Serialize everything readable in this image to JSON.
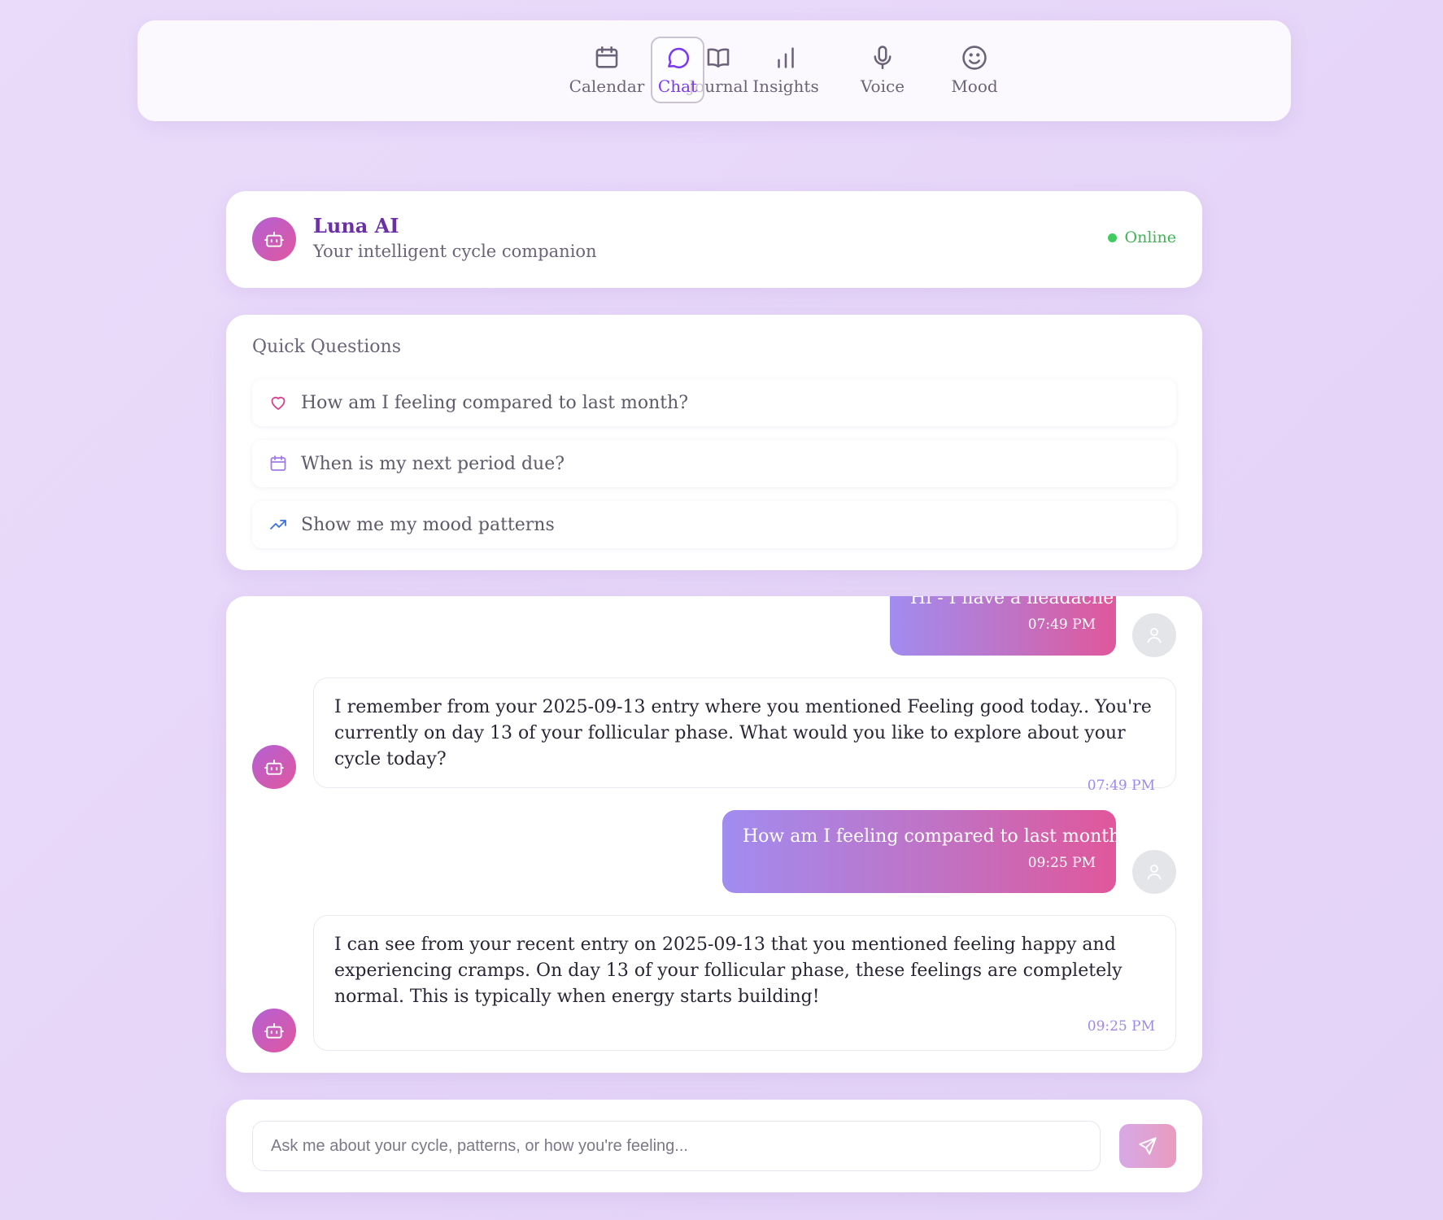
{
  "nav": {
    "items": [
      {
        "label": "Calendar",
        "icon": "calendar-icon"
      },
      {
        "label": "Journal",
        "icon": "book-icon"
      },
      {
        "label": "Chat",
        "icon": "chat-bubble-icon",
        "active": true
      },
      {
        "label": "Insights",
        "icon": "bar-chart-icon"
      },
      {
        "label": "Voice",
        "icon": "microphone-icon"
      },
      {
        "label": "Mood",
        "icon": "smile-icon"
      }
    ]
  },
  "header": {
    "title": "Luna AI",
    "subtitle": "Your intelligent cycle companion",
    "status": "Online",
    "avatar_icon": "bot-icon"
  },
  "quick_questions": {
    "title": "Quick Questions",
    "items": [
      {
        "label": "How am I feeling compared to last month?",
        "icon": "heart-icon"
      },
      {
        "label": "When is my next period due?",
        "icon": "calendar-icon"
      },
      {
        "label": "Show me my mood patterns",
        "icon": "trending-up-icon"
      }
    ]
  },
  "messages": [
    {
      "sender": "user",
      "text": "Hi - I have a headache",
      "time": "07:49 PM"
    },
    {
      "sender": "bot",
      "text": "I remember from your 2025-09-13 entry where you mentioned Feeling good today.. You're currently on day 13 of your follicular phase. What would you like to explore about your cycle today?",
      "time": "07:49 PM"
    },
    {
      "sender": "user",
      "text": "How am I feeling compared to last month?",
      "time": "09:25 PM"
    },
    {
      "sender": "bot",
      "text": "I can see from your recent entry on 2025-09-13 that you mentioned feeling happy and experiencing cramps. On day 13 of your follicular phase, these feelings are completely normal. This is typically when energy starts building!",
      "time": "09:25 PM"
    }
  ],
  "composer": {
    "placeholder": "Ask me about your cycle, patterns, or how you're feeling...",
    "send_icon": "send-icon"
  },
  "colors": {
    "accent": "#7c3aed",
    "brand_title": "#6b2fa6",
    "online": "#3db554",
    "gradient_start": "#a18cf0",
    "gradient_end": "#e0579b"
  }
}
